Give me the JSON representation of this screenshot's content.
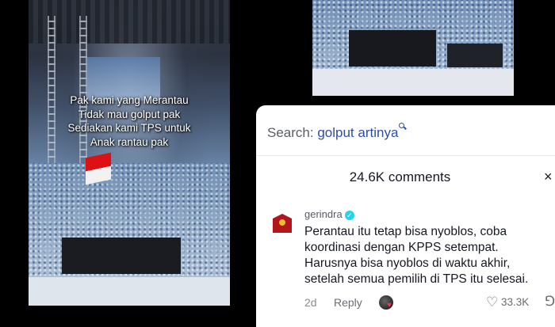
{
  "video_left": {
    "caption": "Pak kami yang Merantau\nTidak mau golput pak\nSediakan kami TPS untuk\nAnak rantau pak"
  },
  "search": {
    "label": "Search:",
    "keyword": "golput artinya"
  },
  "comments": {
    "count_label": "24.6K comments",
    "close_symbol": "×"
  },
  "comment": {
    "username": "gerindra",
    "verified_mark": "✓",
    "text": "Perantau itu tetap bisa nyoblos, coba\nkoordinasi dengan KPPS setempat.\nHarusnya bisa nyoblos di waktu akhir,\nsetelah semua pemilih di TPS itu selesai.",
    "time": "2d",
    "reply_label": "Reply",
    "likes": "33.3K",
    "avatar_brand": "GERINDRA"
  },
  "icons": {
    "heart": "♡",
    "dislike": "⅁"
  },
  "colors": {
    "verified": "#20d5ec",
    "search_keyword": "#2a4fa3",
    "creator_heart": "#fe2c55"
  }
}
